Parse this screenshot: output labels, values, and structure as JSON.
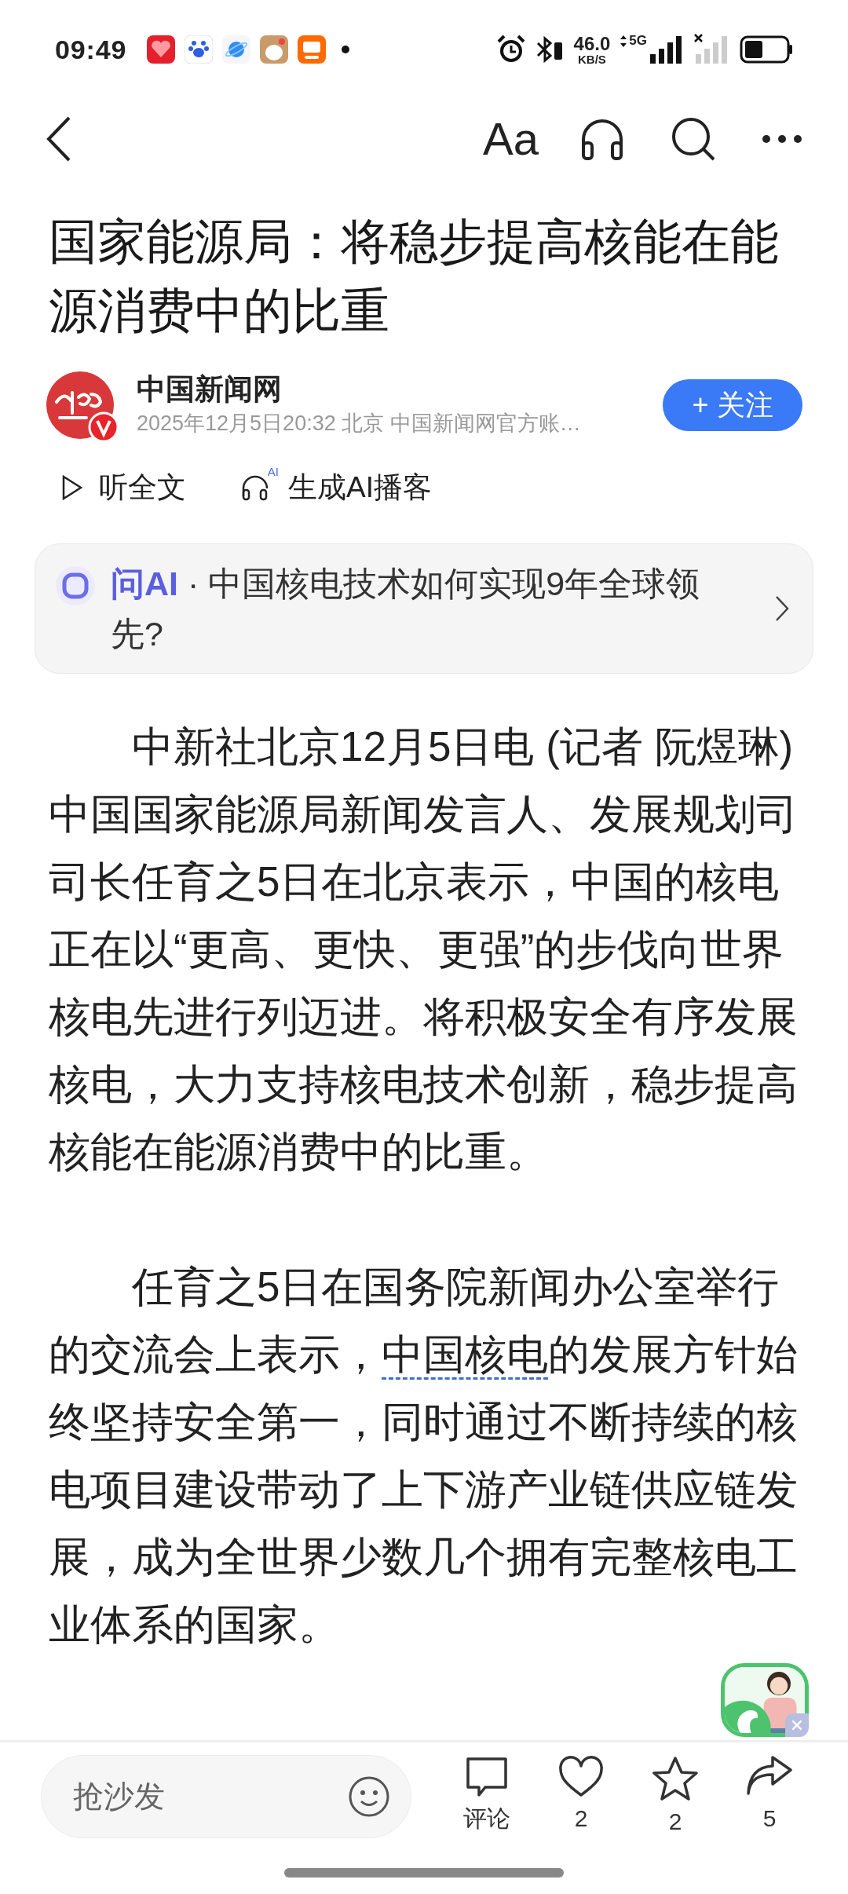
{
  "status_bar": {
    "time": "09:49",
    "net_speed": "46.0",
    "net_unit": "KB/S",
    "network": "5G"
  },
  "toolbar": {
    "font_button": "Aa"
  },
  "article": {
    "title": "国家能源局：将稳步提高核能在能源消费中的比重",
    "author": {
      "name": "中国新闻网",
      "meta": "2025年12月5日20:32 北京 中国新闻网官方账…",
      "follow_button": "+ 关注",
      "followed": false
    },
    "actions": [
      {
        "kind": "listen",
        "label": "听全文"
      },
      {
        "kind": "podcast",
        "label": "生成AI播客",
        "badge": "AI"
      }
    ],
    "ask_ai": {
      "text": "**问AI** · 中国核电技术如何实现9年全球领先?"
    },
    "paragraphs": [
      [
        {
          "kind": "text",
          "text": "中新社北京12月5日电 (记者 阮煜琳)中国国家能源局新闻发言人、发展规划司司长任育之5日在北京表示，中国的核电正在以“更高、更快、更强”的步伐向世界核电先进行列迈进。将积极安全有序发展核电，大力支持核电技术创新，稳步提高核能在能源消费中的比重。"
        }
      ],
      [
        {
          "kind": "text",
          "text": "任育之5日在国务院新闻办公室举行的交流会上表示，"
        },
        {
          "kind": "link",
          "text": "中国核电"
        },
        {
          "kind": "text",
          "text": "的发展方针始终坚持安全第一，同时通过不断持续的核电项目建设带动了上下游产业链供应链发展，成为全世界少数几个拥有完整核电工业体系的国家。"
        }
      ]
    ]
  },
  "bottom_bar": {
    "comment_placeholder": "抢沙发",
    "comment_label": "评论",
    "likes": "2",
    "favorites": "2",
    "shares": "5"
  }
}
